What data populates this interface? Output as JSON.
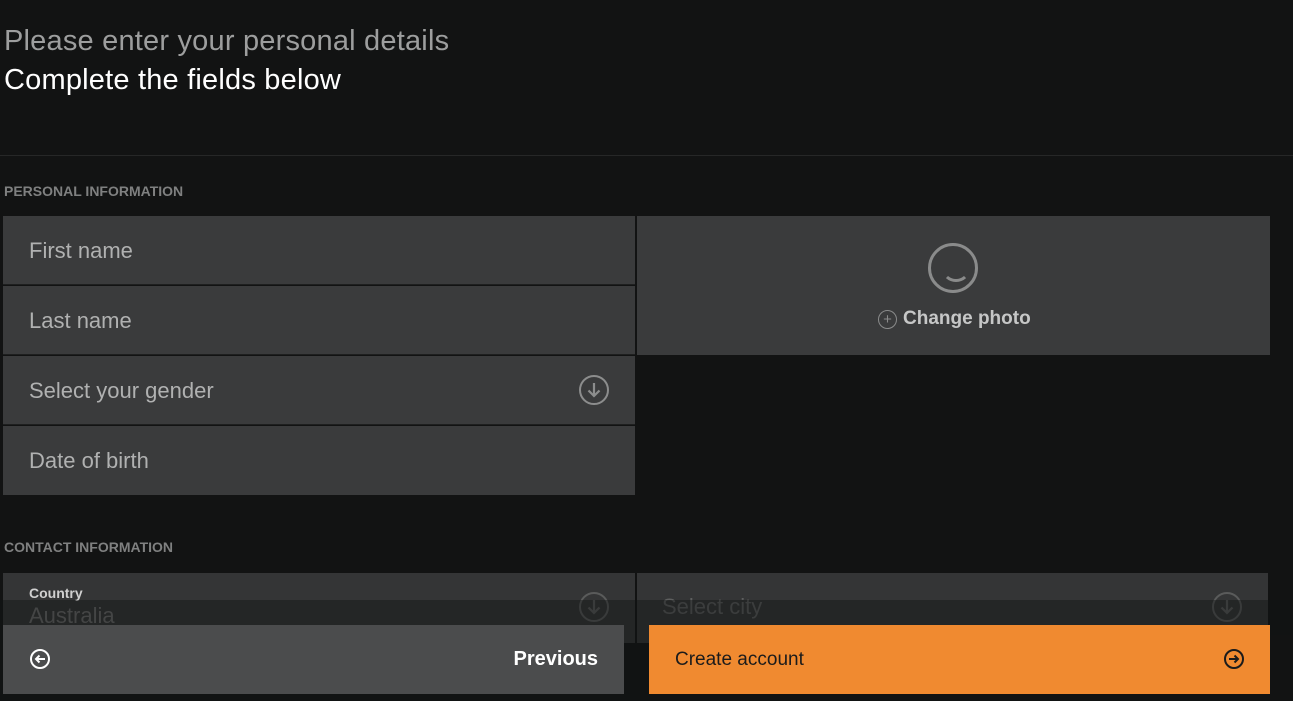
{
  "header": {
    "subtitle": "Please enter your personal details",
    "title": "Complete the fields below"
  },
  "personal_section": {
    "label": "PERSONAL INFORMATION",
    "first_name_placeholder": "First name",
    "last_name_placeholder": "Last name",
    "gender_placeholder": "Select your gender",
    "dob_placeholder": "Date of birth",
    "photo": {
      "icon": "smiley-icon",
      "change_label": "Change photo"
    }
  },
  "contact_section": {
    "label": "CONTACT INFORMATION",
    "country": {
      "label": "Country",
      "value": "Australia"
    },
    "city_placeholder": "Select city"
  },
  "footer": {
    "previous_label": "Previous",
    "create_label": "Create account"
  },
  "colors": {
    "accent": "#f08a30",
    "background": "#121313",
    "field": "#3a3b3c"
  }
}
